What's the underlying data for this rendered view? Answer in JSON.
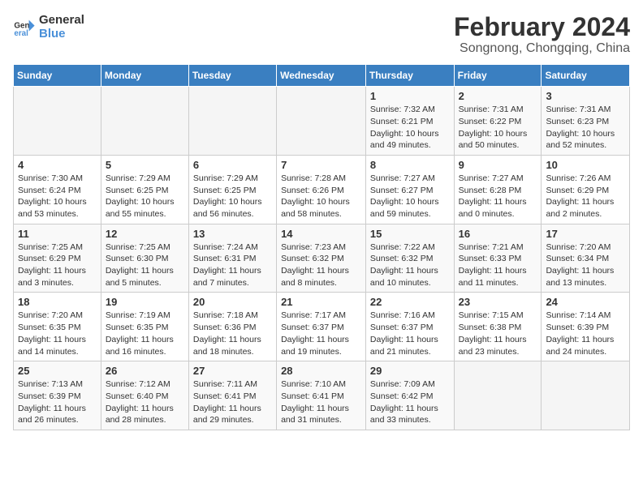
{
  "logo": {
    "line1": "General",
    "line2": "Blue"
  },
  "title": "February 2024",
  "subtitle": "Songnong, Chongqing, China",
  "days_of_week": [
    "Sunday",
    "Monday",
    "Tuesday",
    "Wednesday",
    "Thursday",
    "Friday",
    "Saturday"
  ],
  "weeks": [
    [
      {
        "day": "",
        "info": ""
      },
      {
        "day": "",
        "info": ""
      },
      {
        "day": "",
        "info": ""
      },
      {
        "day": "",
        "info": ""
      },
      {
        "day": "1",
        "info": "Sunrise: 7:32 AM\nSunset: 6:21 PM\nDaylight: 10 hours\nand 49 minutes."
      },
      {
        "day": "2",
        "info": "Sunrise: 7:31 AM\nSunset: 6:22 PM\nDaylight: 10 hours\nand 50 minutes."
      },
      {
        "day": "3",
        "info": "Sunrise: 7:31 AM\nSunset: 6:23 PM\nDaylight: 10 hours\nand 52 minutes."
      }
    ],
    [
      {
        "day": "4",
        "info": "Sunrise: 7:30 AM\nSunset: 6:24 PM\nDaylight: 10 hours\nand 53 minutes."
      },
      {
        "day": "5",
        "info": "Sunrise: 7:29 AM\nSunset: 6:25 PM\nDaylight: 10 hours\nand 55 minutes."
      },
      {
        "day": "6",
        "info": "Sunrise: 7:29 AM\nSunset: 6:25 PM\nDaylight: 10 hours\nand 56 minutes."
      },
      {
        "day": "7",
        "info": "Sunrise: 7:28 AM\nSunset: 6:26 PM\nDaylight: 10 hours\nand 58 minutes."
      },
      {
        "day": "8",
        "info": "Sunrise: 7:27 AM\nSunset: 6:27 PM\nDaylight: 10 hours\nand 59 minutes."
      },
      {
        "day": "9",
        "info": "Sunrise: 7:27 AM\nSunset: 6:28 PM\nDaylight: 11 hours\nand 0 minutes."
      },
      {
        "day": "10",
        "info": "Sunrise: 7:26 AM\nSunset: 6:29 PM\nDaylight: 11 hours\nand 2 minutes."
      }
    ],
    [
      {
        "day": "11",
        "info": "Sunrise: 7:25 AM\nSunset: 6:29 PM\nDaylight: 11 hours\nand 3 minutes."
      },
      {
        "day": "12",
        "info": "Sunrise: 7:25 AM\nSunset: 6:30 PM\nDaylight: 11 hours\nand 5 minutes."
      },
      {
        "day": "13",
        "info": "Sunrise: 7:24 AM\nSunset: 6:31 PM\nDaylight: 11 hours\nand 7 minutes."
      },
      {
        "day": "14",
        "info": "Sunrise: 7:23 AM\nSunset: 6:32 PM\nDaylight: 11 hours\nand 8 minutes."
      },
      {
        "day": "15",
        "info": "Sunrise: 7:22 AM\nSunset: 6:32 PM\nDaylight: 11 hours\nand 10 minutes."
      },
      {
        "day": "16",
        "info": "Sunrise: 7:21 AM\nSunset: 6:33 PM\nDaylight: 11 hours\nand 11 minutes."
      },
      {
        "day": "17",
        "info": "Sunrise: 7:20 AM\nSunset: 6:34 PM\nDaylight: 11 hours\nand 13 minutes."
      }
    ],
    [
      {
        "day": "18",
        "info": "Sunrise: 7:20 AM\nSunset: 6:35 PM\nDaylight: 11 hours\nand 14 minutes."
      },
      {
        "day": "19",
        "info": "Sunrise: 7:19 AM\nSunset: 6:35 PM\nDaylight: 11 hours\nand 16 minutes."
      },
      {
        "day": "20",
        "info": "Sunrise: 7:18 AM\nSunset: 6:36 PM\nDaylight: 11 hours\nand 18 minutes."
      },
      {
        "day": "21",
        "info": "Sunrise: 7:17 AM\nSunset: 6:37 PM\nDaylight: 11 hours\nand 19 minutes."
      },
      {
        "day": "22",
        "info": "Sunrise: 7:16 AM\nSunset: 6:37 PM\nDaylight: 11 hours\nand 21 minutes."
      },
      {
        "day": "23",
        "info": "Sunrise: 7:15 AM\nSunset: 6:38 PM\nDaylight: 11 hours\nand 23 minutes."
      },
      {
        "day": "24",
        "info": "Sunrise: 7:14 AM\nSunset: 6:39 PM\nDaylight: 11 hours\nand 24 minutes."
      }
    ],
    [
      {
        "day": "25",
        "info": "Sunrise: 7:13 AM\nSunset: 6:39 PM\nDaylight: 11 hours\nand 26 minutes."
      },
      {
        "day": "26",
        "info": "Sunrise: 7:12 AM\nSunset: 6:40 PM\nDaylight: 11 hours\nand 28 minutes."
      },
      {
        "day": "27",
        "info": "Sunrise: 7:11 AM\nSunset: 6:41 PM\nDaylight: 11 hours\nand 29 minutes."
      },
      {
        "day": "28",
        "info": "Sunrise: 7:10 AM\nSunset: 6:41 PM\nDaylight: 11 hours\nand 31 minutes."
      },
      {
        "day": "29",
        "info": "Sunrise: 7:09 AM\nSunset: 6:42 PM\nDaylight: 11 hours\nand 33 minutes."
      },
      {
        "day": "",
        "info": ""
      },
      {
        "day": "",
        "info": ""
      }
    ]
  ]
}
